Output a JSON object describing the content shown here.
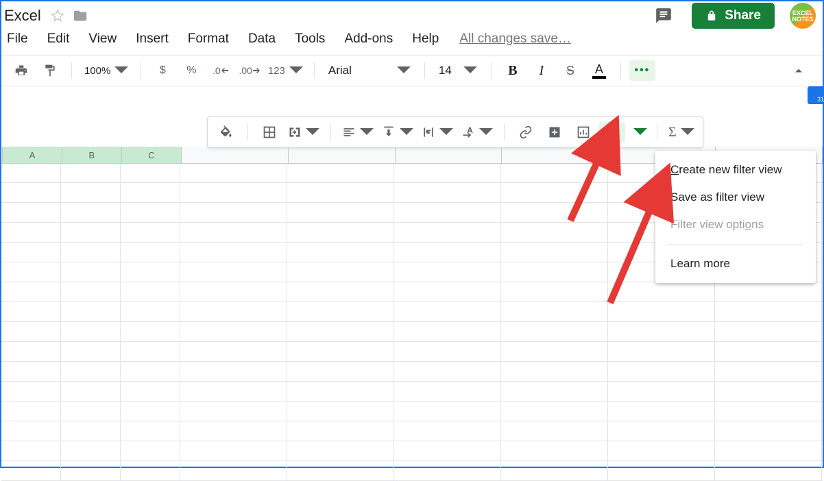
{
  "title_bar": {
    "doc_title": "Excel",
    "share_label": "Share",
    "avatar_line1": "EXCEL",
    "avatar_line2": "NOTES"
  },
  "menu": {
    "items": [
      "File",
      "Edit",
      "View",
      "Insert",
      "Format",
      "Data",
      "Tools",
      "Add-ons",
      "Help"
    ],
    "save_status": "All changes save…"
  },
  "toolbar": {
    "zoom": "100%",
    "currency": "$",
    "percent": "%",
    "dec_dec": ".0",
    "inc_dec": ".00",
    "more_fmt": "123",
    "font": "Arial",
    "size": "14",
    "bold": "B",
    "italic": "I",
    "strike": "S",
    "textcolor": "A",
    "more": "•••",
    "cal_badge": "31"
  },
  "overflow": {
    "sigma": "Σ"
  },
  "filter_menu": {
    "create": "Create new filter view",
    "save": "Save as filter view",
    "options": "Filter view options",
    "learn": "Learn more",
    "underline_c": "C",
    "underline_o": "o"
  },
  "columns": {
    "labels": [
      "A",
      "B",
      "C"
    ],
    "rest_count": 6,
    "sel_count": 3,
    "widths": {
      "sel": 86,
      "rest": 155
    }
  },
  "grid": {
    "row_count": 16
  }
}
